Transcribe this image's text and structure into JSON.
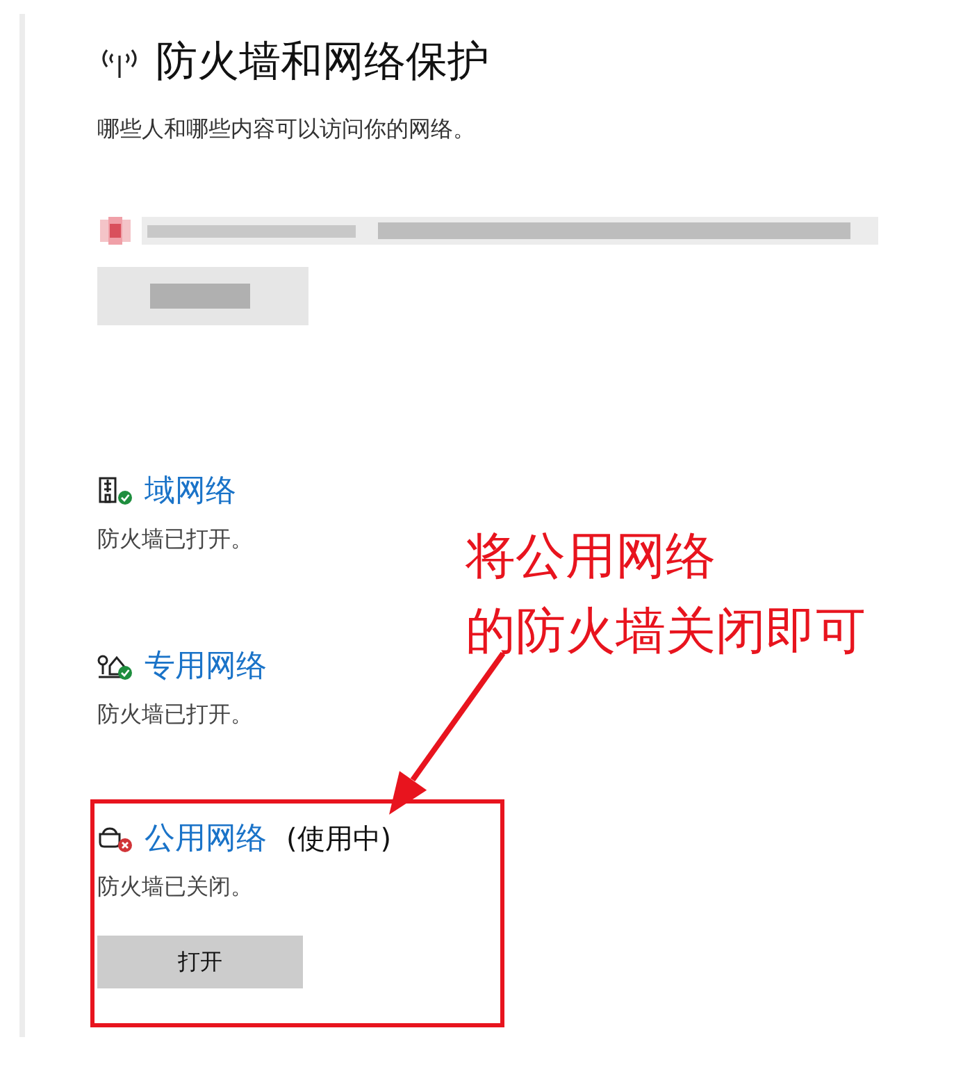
{
  "header": {
    "title": "防火墙和网络保护",
    "subtitle": "哪些人和哪些内容可以访问你的网络。"
  },
  "networks": [
    {
      "kind": "domain",
      "name": "域网络",
      "firewall_on": true,
      "highlighted": false,
      "status": "防火墙已打开。"
    },
    {
      "kind": "private",
      "name": "专用网络",
      "firewall_on": true,
      "highlighted": false,
      "status": "防火墙已打开。"
    },
    {
      "kind": "public",
      "name": "公用网络",
      "tag": "(使用中)",
      "firewall_on": false,
      "highlighted": true,
      "status": "防火墙已关闭。",
      "button": "打开"
    }
  ],
  "annotation": {
    "lines": [
      "将公用网络",
      "的防火墙关闭即可"
    ]
  }
}
